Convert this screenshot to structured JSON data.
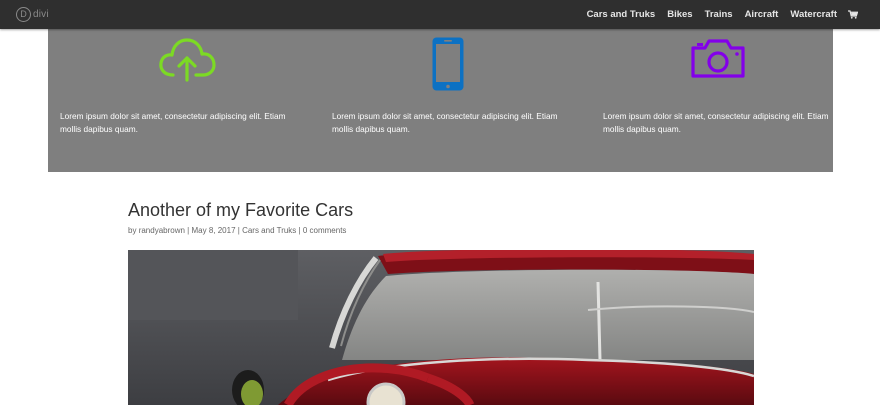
{
  "header": {
    "logo_letter": "D",
    "logo_text": "divi",
    "nav": [
      "Cars and Truks",
      "Bikes",
      "Trains",
      "Aircraft",
      "Watercraft"
    ],
    "cart_icon": "shopping-cart-icon"
  },
  "features": {
    "background": "#7f7f7f",
    "blurbs": [
      {
        "icon": "cloud-upload-icon",
        "color": "#7cda24",
        "text": "Lorem ipsum dolor sit amet, consectetur adipiscing elit. Etiam mollis dapibus quam."
      },
      {
        "icon": "smartphone-icon",
        "color": "#0c71c3",
        "text": "Lorem ipsum dolor sit amet, consectetur adipiscing elit. Etiam mollis dapibus quam."
      },
      {
        "icon": "camera-icon",
        "color": "#8300e9",
        "text": "Lorem ipsum dolor sit amet, consectetur adipiscing elit. Etiam mollis dapibus quam."
      }
    ]
  },
  "post": {
    "title": "Another of my Favorite Cars",
    "meta_prefix": "by",
    "author": "randyabrown",
    "date": "May 8, 2017",
    "category": "Cars and Truks",
    "comments": "0 comments",
    "separator": "|",
    "image_subject": "red classic convertible car interior"
  }
}
